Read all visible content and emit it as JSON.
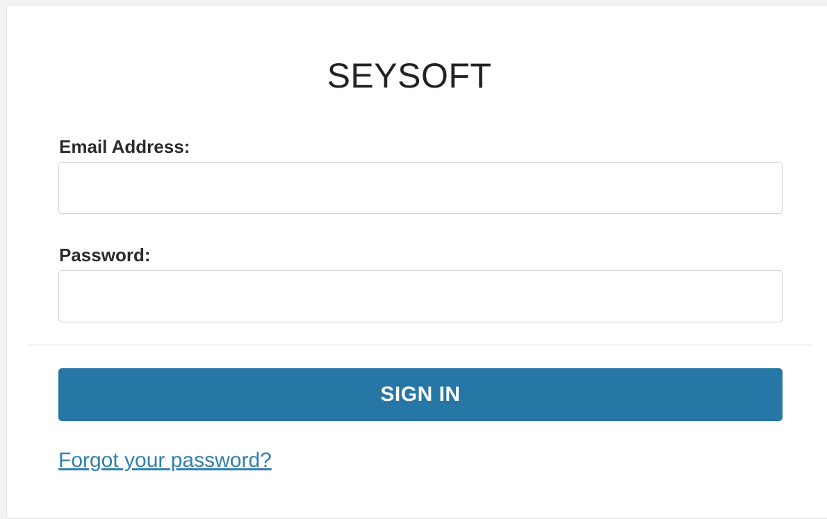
{
  "app": {
    "title": "SEYSOFT"
  },
  "form": {
    "email_label": "Email Address:",
    "email_value": "",
    "email_placeholder": "",
    "password_label": "Password:",
    "password_value": "",
    "password_placeholder": "",
    "signin_label": "SIGN IN",
    "forgot_label": "Forgot your password?"
  },
  "colors": {
    "primary_button": "#2677a6",
    "link": "#2f7fb0"
  }
}
